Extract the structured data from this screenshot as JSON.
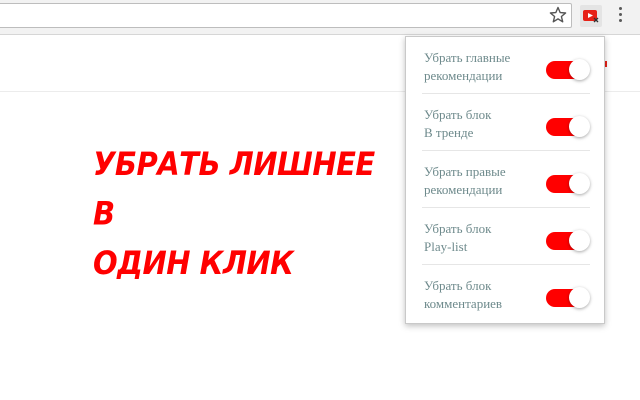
{
  "colors": {
    "accent": "#ff0000",
    "toggle_on": "#ff0000",
    "label_text": "#6e8a8c"
  },
  "toolbar": {
    "icons": [
      "star-icon",
      "youtube-extension-icon",
      "menu-icon"
    ]
  },
  "promo": {
    "line1": "УБРАТЬ ЛИШНЕЕ",
    "line2": "В",
    "line3": "ОДИН КЛИК"
  },
  "popup": {
    "options": [
      {
        "line1": "Убрать главные",
        "line2": "рекомендации",
        "enabled": true
      },
      {
        "line1": "Убрать блок",
        "line2": "В тренде",
        "enabled": true
      },
      {
        "line1": "Убрать правые",
        "line2": "рекомендации",
        "enabled": true
      },
      {
        "line1": "Убрать блок",
        "line2": "Play-list",
        "enabled": true
      },
      {
        "line1": "Убрать блок",
        "line2": "комментариев",
        "enabled": true
      }
    ]
  }
}
